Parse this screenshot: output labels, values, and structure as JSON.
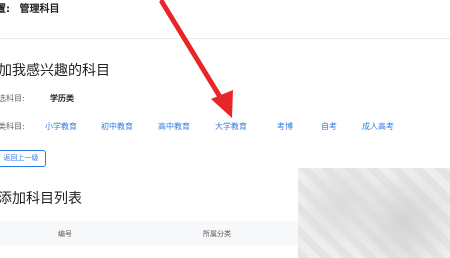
{
  "breadcrumb": {
    "prefix": "置:",
    "current": "管理科目"
  },
  "add_section": {
    "title": "加我感兴趣的科目",
    "type_label": "选科目:",
    "type_value": "学历类",
    "category_label": "类科目:",
    "categories": [
      "小学教育",
      "初中教育",
      "高中教育",
      "大学教育",
      "考博",
      "自考",
      "成人高考"
    ],
    "back_button": "返回上一级"
  },
  "list_section": {
    "title": "添加科目列表",
    "columns": [
      "编号",
      "所属分类"
    ]
  },
  "annotation": {
    "arrow_color": "#e8262a"
  }
}
